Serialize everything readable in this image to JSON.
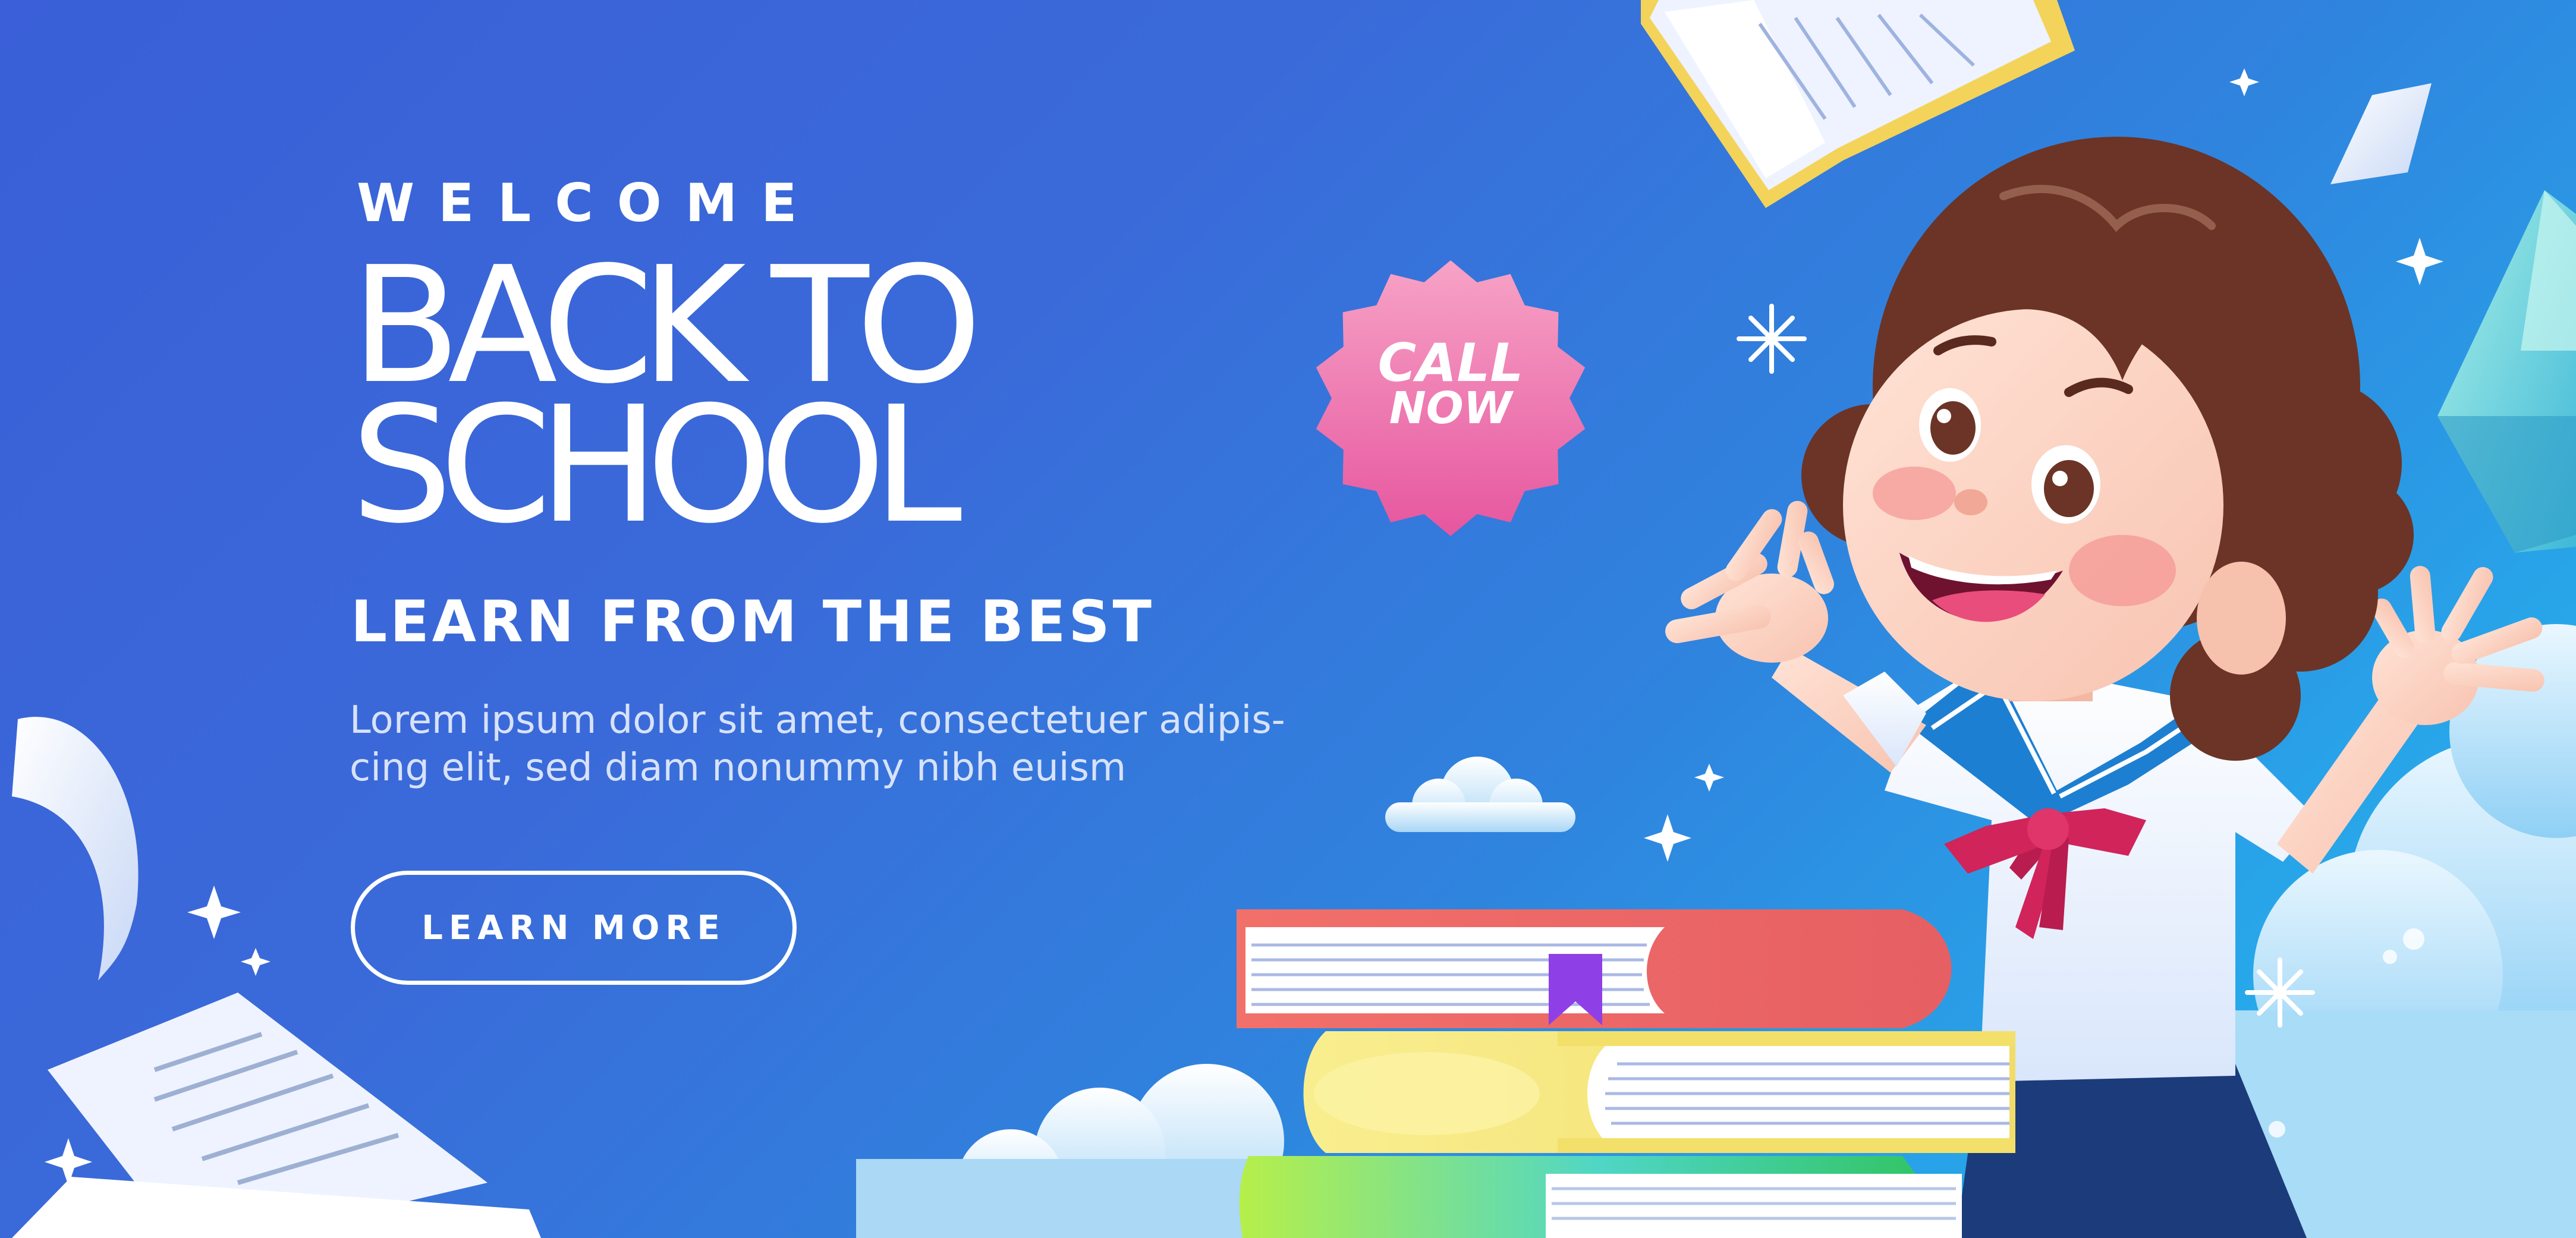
{
  "banner": {
    "welcome": "WELCOME",
    "headline_line1": "BACK TO",
    "headline_line2": "SCHOOL",
    "tagline": "LEARN FROM THE BEST",
    "body_line1": "Lorem ipsum dolor sit amet, consectetuer adipis-",
    "body_line2": "cing elit, sed diam nonummy nibh euism",
    "button_label": "LEARN MORE"
  },
  "badge": {
    "line1": "CALL",
    "line2": "NOW"
  },
  "colors": {
    "background_left": "#3a5fd8",
    "background_right": "#3cc2f2",
    "badge_top": "#f7a3c6",
    "badge_bottom": "#e6569f",
    "book_red": "#ec6a6a",
    "book_yellow": "#f5e57a",
    "book_green": "#8fe04a",
    "hair": "#6b3426",
    "bow": "#d0245a",
    "collar": "#1d7fd1"
  }
}
